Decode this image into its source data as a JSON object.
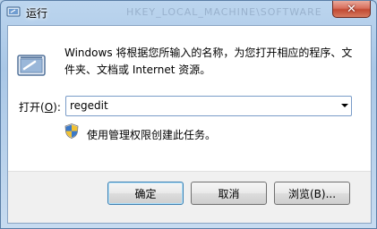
{
  "window": {
    "title": "运行",
    "background_title": "HKEY_LOCAL_MACHINE\\SOFTWARE",
    "close_label": "✕"
  },
  "dialog": {
    "description": "Windows 将根据您所输入的名称，为您打开相应的程序、文件夹、文档或 Internet 资源。",
    "open_label": "打开(",
    "open_accel": "O",
    "open_label_tail": "):",
    "open_value": "regedit",
    "admin_note": "使用管理权限创建此任务。"
  },
  "buttons": {
    "ok": "确定",
    "cancel": "取消",
    "browse": "浏览(B)..."
  },
  "icons": {
    "app": "run-icon",
    "shield": "uac-shield-icon",
    "close": "close-icon",
    "dropdown": "chevron-down-icon"
  },
  "colors": {
    "frame": "#a9c7e6",
    "close_button": "#c24a33",
    "default_button_border": "#3c7fb1"
  }
}
